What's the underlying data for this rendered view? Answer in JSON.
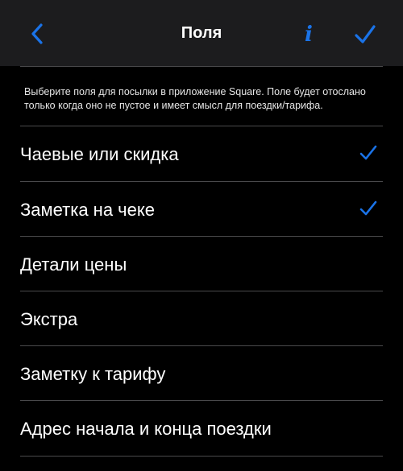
{
  "colors": {
    "accent": "#1a73e8",
    "background": "#000000",
    "navbar": "#1c1c1e",
    "divider": "#4a4a4c"
  },
  "nav": {
    "title": "Поля",
    "back_icon": "chevron-left-icon",
    "info_label": "i",
    "done_icon": "checkmark-icon"
  },
  "description": "Выберите поля для посылки в приложение Square. Поле будет отослано только когда оно не пустое и имеет смысл для поездки/тарифа.",
  "fields": [
    {
      "label": "Чаевые или скидка",
      "checked": true
    },
    {
      "label": "Заметка на чеке",
      "checked": true
    },
    {
      "label": "Детали цены",
      "checked": false
    },
    {
      "label": "Экстра",
      "checked": false
    },
    {
      "label": "Заметку к тарифу",
      "checked": false
    },
    {
      "label": "Адрес начала и конца поездки",
      "checked": false
    }
  ]
}
